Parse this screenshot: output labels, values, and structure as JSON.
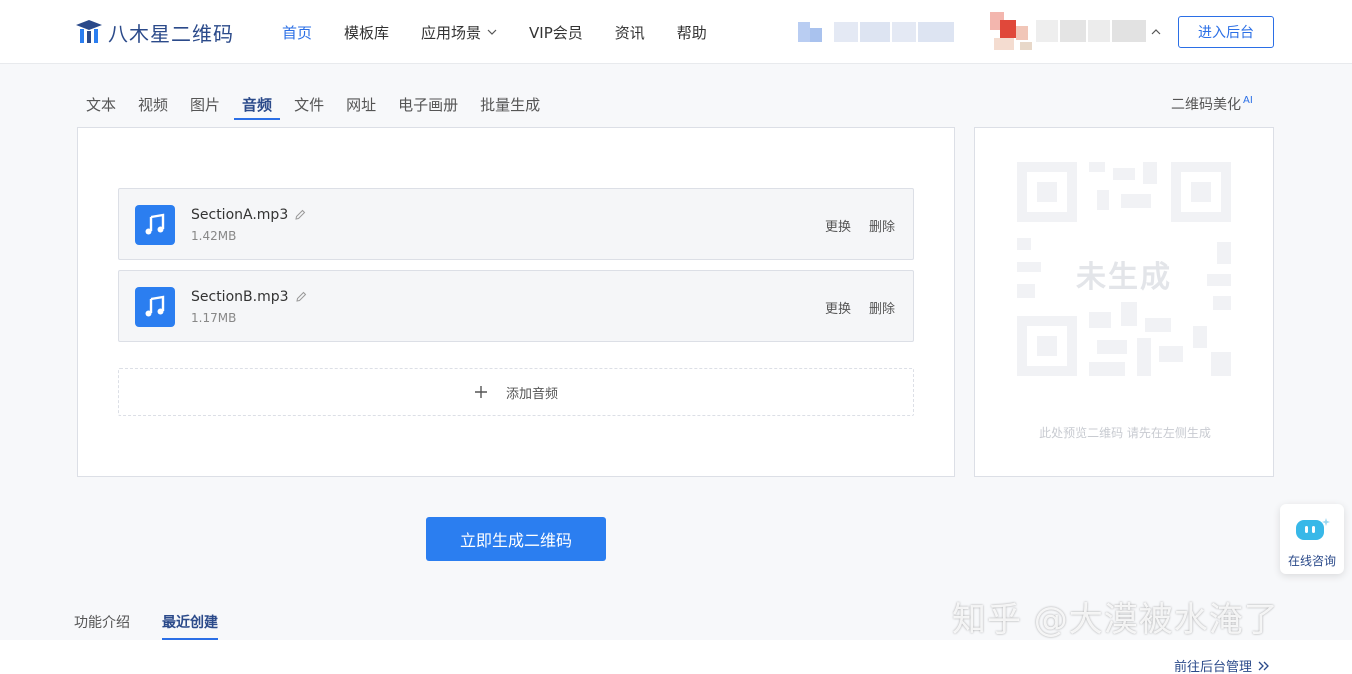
{
  "header": {
    "logo_text": "八木星二维码",
    "nav": [
      {
        "label": "首页",
        "active": true
      },
      {
        "label": "模板库"
      },
      {
        "label": "应用场景",
        "has_dropdown": true
      },
      {
        "label": "VIP会员"
      },
      {
        "label": "资讯"
      },
      {
        "label": "帮助"
      }
    ],
    "enter_backend": "进入后台"
  },
  "tabs": [
    "文本",
    "视频",
    "图片",
    "音频",
    "文件",
    "网址",
    "电子画册",
    "批量生成"
  ],
  "active_tab": "音频",
  "beautify": {
    "label": "二维码美化",
    "badge": "AI"
  },
  "files": [
    {
      "name": "SectionA.mp3",
      "size": "1.42MB",
      "replace": "更换",
      "delete": "删除"
    },
    {
      "name": "SectionB.mp3",
      "size": "1.17MB",
      "replace": "更换",
      "delete": "删除"
    }
  ],
  "add_audio": "添加音频",
  "preview": {
    "status": "未生成",
    "hint": "此处预览二维码 请先在左侧生成"
  },
  "generate_button": "立即生成二维码",
  "chat": {
    "label": "在线咨询"
  },
  "bottom_tabs": [
    {
      "label": "功能介绍"
    },
    {
      "label": "最近创建",
      "active": true
    }
  ],
  "backend_link": "前往后台管理",
  "watermark": "知乎 @大漠被水淹了",
  "colors": {
    "accent": "#2b7ef0",
    "brand_dark": "#2b4a8a"
  }
}
